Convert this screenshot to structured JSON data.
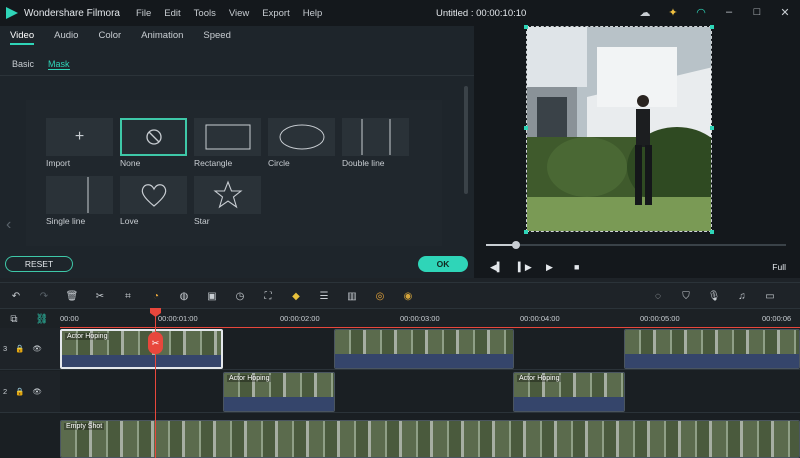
{
  "app": {
    "name": "Wondershare Filmora",
    "doc_title": "Untitled : 00:00:10:10",
    "menu": [
      "File",
      "Edit",
      "Tools",
      "View",
      "Export",
      "Help"
    ]
  },
  "panel": {
    "tabs": [
      "Video",
      "Audio",
      "Color",
      "Animation",
      "Speed"
    ],
    "subtabs": [
      "Basic",
      "Mask"
    ],
    "masks": [
      {
        "label": "Import"
      },
      {
        "label": "None"
      },
      {
        "label": "Rectangle"
      },
      {
        "label": "Circle"
      },
      {
        "label": "Double line"
      },
      {
        "label": "Single line"
      },
      {
        "label": "Love"
      },
      {
        "label": "Star"
      }
    ],
    "reset_label": "RESET",
    "ok_label": "OK"
  },
  "preview": {
    "progress": 0.1,
    "full_label": "Full"
  },
  "ruler": {
    "ticks": [
      "00:00",
      "00:00:01:00",
      "00:00:02:00",
      "00:00:03:00",
      "00:00:04:00",
      "00:00:05:00",
      "00:00:06"
    ]
  },
  "tracks": [
    {
      "id": "3",
      "clips": [
        {
          "label": "Actor Hoping"
        },
        {
          "label": ""
        },
        {
          "label": ""
        }
      ]
    },
    {
      "id": "2",
      "clips": [
        {
          "label": "Actor Hoping"
        },
        {
          "label": "Actor Hoping"
        }
      ]
    },
    {
      "id": "1",
      "clips": [
        {
          "label": "Empty Shot"
        }
      ]
    }
  ],
  "colors": {
    "accent": "#2fd5b8",
    "playhead": "#e8473c"
  }
}
